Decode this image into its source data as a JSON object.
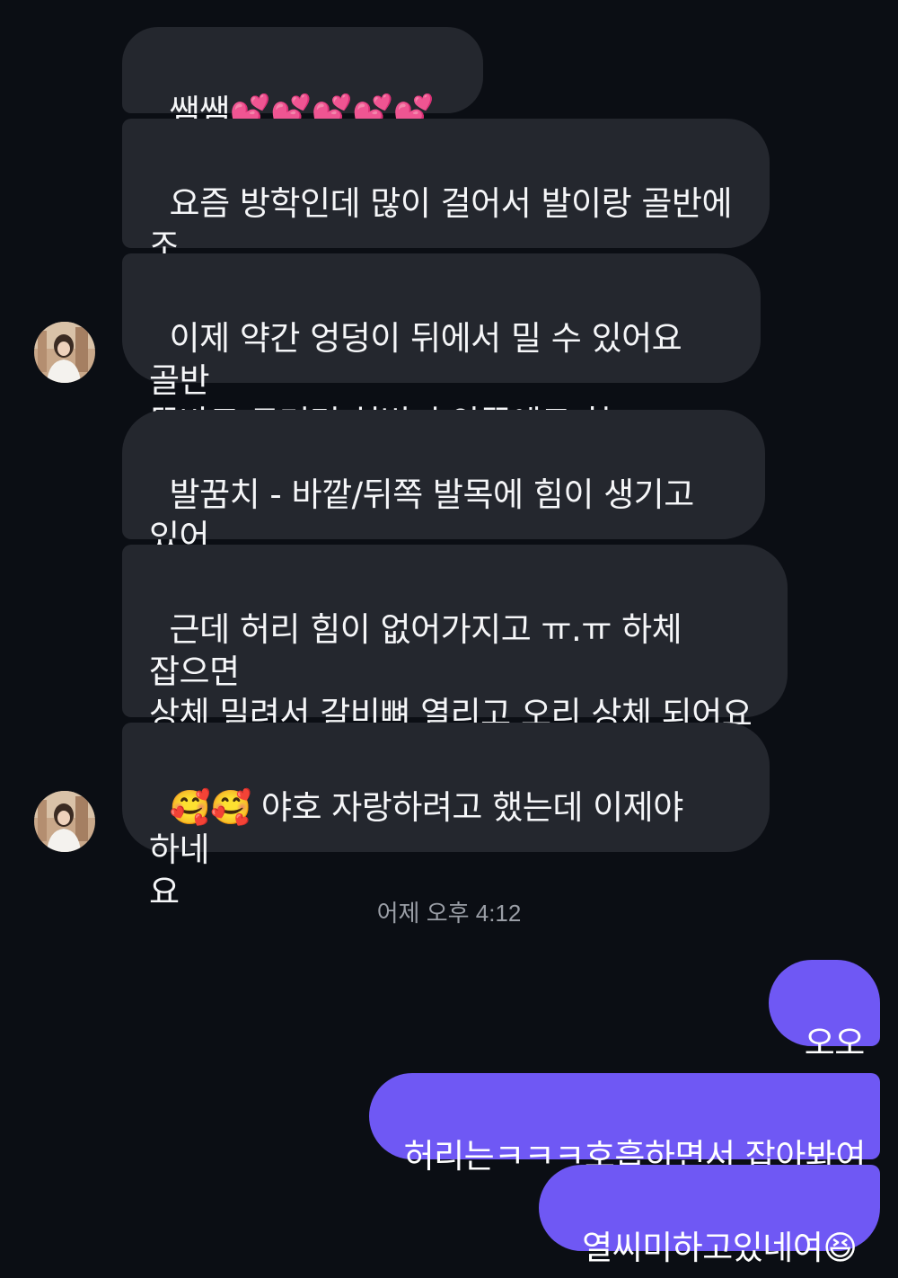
{
  "received": [
    {
      "text": "쌤쌤💕💕💕💕💕"
    },
    {
      "text": "요즘 방학인데 많이 걸어서 발이랑 골반에 조\n금씩 힘 생기고 있어요"
    },
    {
      "text": "이제 약간 엉덩이 뒤에서 밀 수 있어요 골반\n똑바로 두려면 허벅지 안쪽에도 힘 들어가요"
    },
    {
      "text": "발꿈치 - 바깥/뒤쪽 발목에 힘이 생기고 있어\n요"
    },
    {
      "text": "근데 허리 힘이 없어가지고 ㅠ.ㅠ 하체 잡으면\n상체 밀려서 갈비뼈 열리고 오리 상체 되어요\nㅋㅋㅋㅋㅋㅋ"
    },
    {
      "text": "🥰🥰 야호 자랑하려고 했는데 이제야 하네\n요"
    }
  ],
  "timestamp": "어제 오후 4:12",
  "sent": [
    {
      "text": "오오"
    },
    {
      "text": "허리는ㅋㅋㅋ호흡하면서 잡아봐여"
    },
    {
      "text": "열씨미하고있네여😆"
    }
  ],
  "colors": {
    "background": "#0b0e14",
    "received_bubble": "#24272e",
    "sent_bubble": "#6f58f4",
    "timestamp": "#9a9ea6"
  }
}
